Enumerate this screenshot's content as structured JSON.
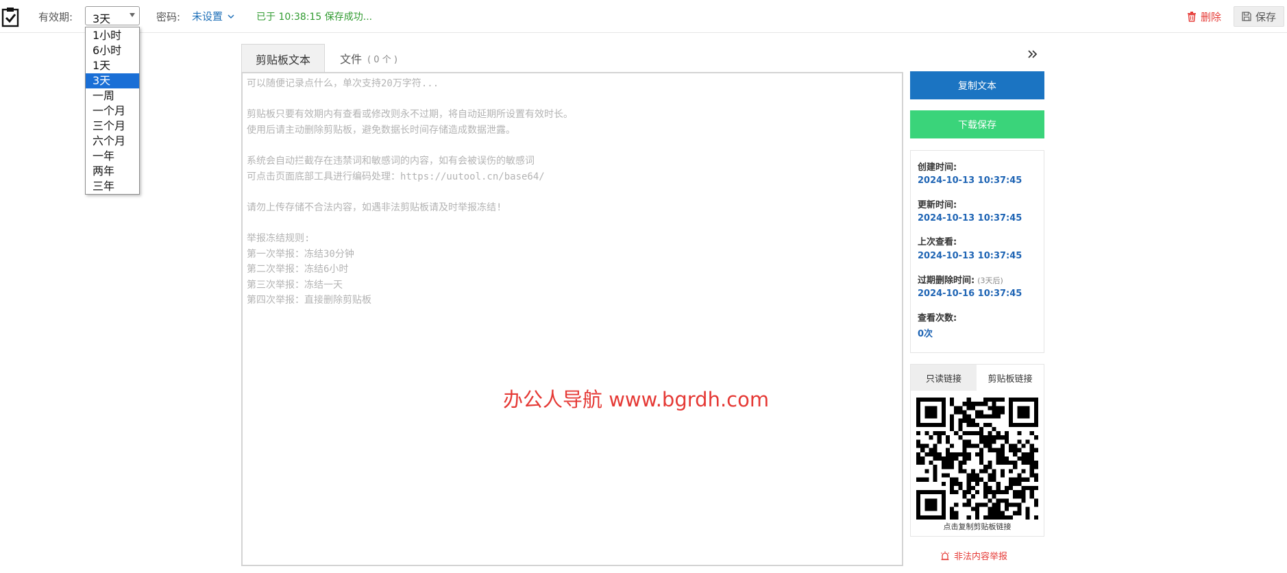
{
  "header": {
    "expiry_label": "有效期:",
    "expiry_value": "3天",
    "password_label": "密码:",
    "password_value": "未设置",
    "save_status": "已于 10:38:15 保存成功...",
    "delete_label": "删除",
    "save_label": "保存"
  },
  "expiry_options": [
    "1小时",
    "6小时",
    "1天",
    "3天",
    "一周",
    "一个月",
    "三个月",
    "六个月",
    "一年",
    "两年",
    "三年"
  ],
  "expiry_selected_index": 3,
  "tabs": {
    "text_label": "剪贴板文本",
    "files_label": "文件",
    "files_count": "( 0 个 )"
  },
  "editor": {
    "placeholder_lines": [
      "可以随便记录点什么，单次支持20万字符...",
      "",
      "剪贴板只要有效期内有查看或修改则永不过期，将自动延期所设置有效时长。",
      "使用后请主动删除剪贴板，避免数据长时间存储造成数据泄露。",
      "",
      "系统会自动拦截存在违禁词和敏感词的内容，如有会被误伤的敏感词",
      "可点击页面底部工具进行编码处理：https://uutool.cn/base64/",
      "",
      "请勿上传存储不合法内容，如遇非法剪贴板请及时举报冻结!",
      "",
      "举报冻结规则:",
      "第一次举报：冻结30分钟",
      "第二次举报：冻结6小时",
      "第三次举报：冻结一天",
      "第四次举报：直接删除剪贴板"
    ],
    "watermark": "办公人导航 www.bgrdh.com"
  },
  "sidebar": {
    "copy_button": "复制文本",
    "download_button": "下载保存",
    "info": {
      "created_label": "创建时间:",
      "created_value": "2024-10-13 10:37:45",
      "updated_label": "更新时间:",
      "updated_value": "2024-10-13 10:37:45",
      "viewed_label": "上次查看:",
      "viewed_value": "2024-10-13 10:37:45",
      "expire_label": "过期删除时间:",
      "expire_note": "(3天后)",
      "expire_value": "2024-10-16 10:37:45",
      "views_label": "查看次数:",
      "views_value": "0次"
    },
    "qr_tabs": {
      "readonly": "只读链接",
      "clipboard": "剪贴板链接"
    },
    "qr_caption": "点击复制剪贴板链接",
    "report_label": "非法内容举报"
  },
  "colors": {
    "primary_blue": "#1b74c2",
    "download_green": "#3ad47a",
    "danger_red": "#e53935",
    "success_green": "#2f9a2f",
    "selected_option": "#1a6fd6"
  },
  "icons": [
    "clipboard-check-icon",
    "chevron-down-icon",
    "trash-icon",
    "floppy-disk-icon",
    "double-chevron-right-icon",
    "alarm-icon"
  ]
}
